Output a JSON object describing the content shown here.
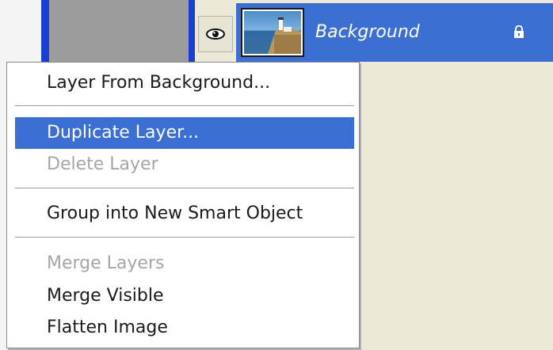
{
  "layers_panel": {
    "layer_name": "Background"
  },
  "context_menu": {
    "items": [
      {
        "label": "Layer From Background...",
        "enabled": true
      },
      {
        "label": "Duplicate Layer...",
        "enabled": true,
        "highlighted": true
      },
      {
        "label": "Delete Layer",
        "enabled": false
      },
      {
        "label": "Group into New Smart Object",
        "enabled": true
      },
      {
        "label": "Merge Layers",
        "enabled": false
      },
      {
        "label": "Merge Visible",
        "enabled": true
      },
      {
        "label": "Flatten Image",
        "enabled": true
      }
    ]
  },
  "colors": {
    "selection_blue": "#3b6fd1",
    "panel_bg": "#ece9d8",
    "disabled_text": "#a6a6a6"
  }
}
